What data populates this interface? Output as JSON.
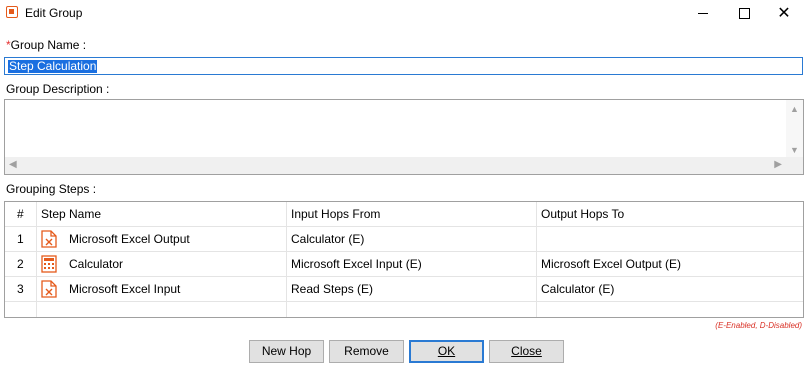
{
  "window": {
    "title": "Edit Group",
    "close_glyph": "✕"
  },
  "form": {
    "required_mark": "*",
    "group_name_label": "Group Name :",
    "group_name_value": "Step Calculation",
    "group_description_label": "Group Description :",
    "group_description_value": "",
    "grouping_steps_label": "Grouping Steps :"
  },
  "grid": {
    "headers": [
      "#",
      "Step Name",
      "Input Hops From",
      "Output Hops To"
    ],
    "rows": [
      {
        "num": "1",
        "icon": "excel-output-icon",
        "name": "Microsoft Excel Output",
        "input": "Calculator (E)",
        "output": ""
      },
      {
        "num": "2",
        "icon": "calculator-icon",
        "name": "Calculator",
        "input": "Microsoft Excel Input (E)",
        "output": "Microsoft Excel Output (E)"
      },
      {
        "num": "3",
        "icon": "excel-input-icon",
        "name": "Microsoft Excel Input",
        "input": "Read Steps (E)",
        "output": "Calculator (E)"
      }
    ],
    "legend": "(E-Enabled, D-Disabled)"
  },
  "buttons": {
    "new_hop": "New Hop",
    "remove": "Remove",
    "ok": "OK",
    "close": "Close"
  },
  "colors": {
    "accent": "#e55a1b",
    "selection": "#1a6fe0",
    "legend": "#d93025"
  }
}
